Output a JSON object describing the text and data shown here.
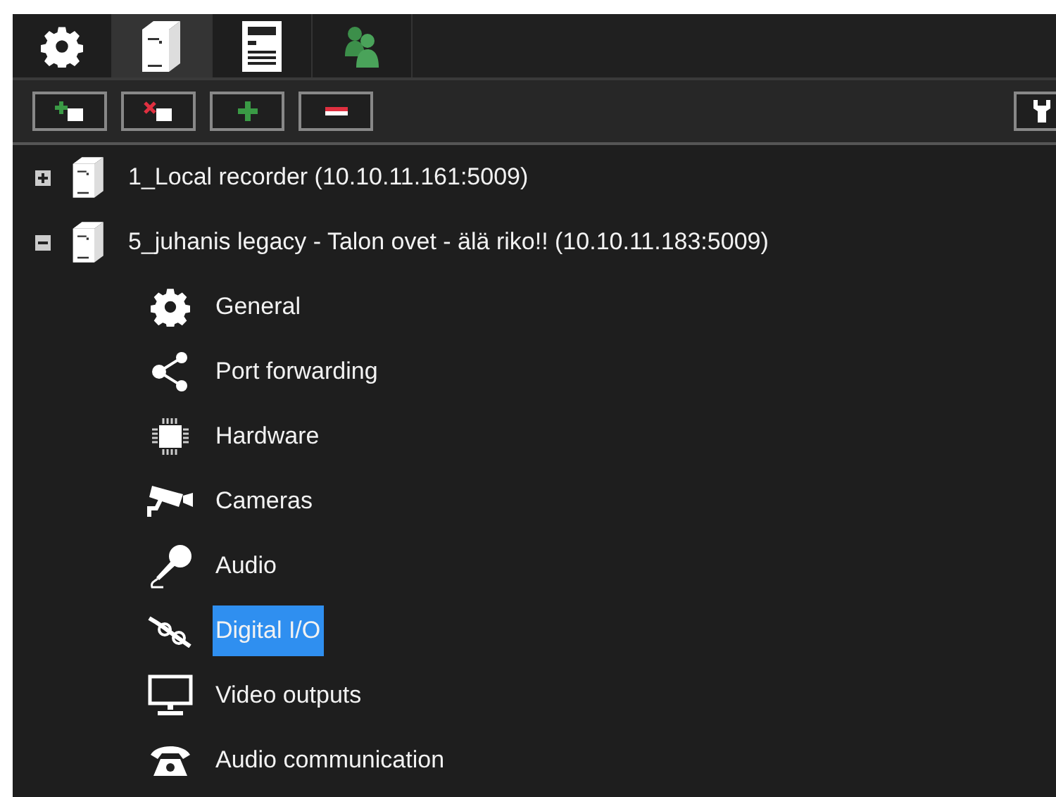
{
  "tabs": [
    {
      "kind": "settings",
      "selected": false
    },
    {
      "kind": "server",
      "selected": true
    },
    {
      "kind": "document",
      "selected": false
    },
    {
      "kind": "users",
      "selected": false
    }
  ],
  "toolbar": {
    "buttons": [
      {
        "kind": "add-server"
      },
      {
        "kind": "remove-server"
      },
      {
        "kind": "add"
      },
      {
        "kind": "remove"
      }
    ],
    "right_buttons": [
      {
        "kind": "wrench"
      }
    ]
  },
  "tree": [
    {
      "label": "1_Local recorder (10.10.11.161:5009)",
      "expanded": false,
      "selected": false
    },
    {
      "label": "5_juhanis legacy - Talon ovet - älä riko!! (10.10.11.183:5009)",
      "expanded": true,
      "selected": false,
      "children": [
        {
          "kind": "general",
          "label": "General",
          "selected": false
        },
        {
          "kind": "port",
          "label": "Port forwarding",
          "selected": false
        },
        {
          "kind": "hardware",
          "label": "Hardware",
          "selected": false
        },
        {
          "kind": "cameras",
          "label": "Cameras",
          "selected": false
        },
        {
          "kind": "audio",
          "label": "Audio",
          "selected": false
        },
        {
          "kind": "io",
          "label": "Digital I/O",
          "selected": true
        },
        {
          "kind": "video",
          "label": "Video outputs",
          "selected": false
        },
        {
          "kind": "phone",
          "label": "Audio communication",
          "selected": false
        }
      ]
    }
  ]
}
